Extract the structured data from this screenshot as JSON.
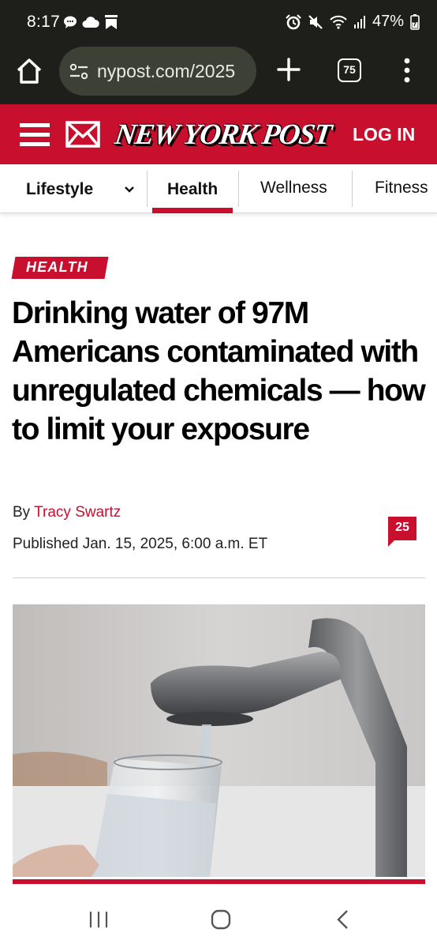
{
  "status_bar": {
    "time": "8:17",
    "battery": "47%"
  },
  "browser": {
    "url": "nypost.com/2025",
    "tab_count": "75"
  },
  "header": {
    "logo": "NEW YORK POST",
    "login_label": "LOG IN",
    "brand_color": "#c8102e"
  },
  "section_nav": {
    "dropdown_label": "Lifestyle",
    "items": [
      "Health",
      "Wellness",
      "Fitness"
    ],
    "active": "Health"
  },
  "article": {
    "tag": "HEALTH",
    "headline": "Drinking water of 97M Americans contaminated with unregulated chemicals — how to limit your exposure",
    "byline_prefix": "By",
    "author": "Tracy Swartz",
    "published": "Published Jan. 15, 2025, 6:00 a.m. ET",
    "comment_count": "25"
  },
  "icons": {
    "status_left": [
      "chat-bubble-icon",
      "cloud-icon",
      "bookmark-flag-icon"
    ],
    "status_right": [
      "alarm-icon",
      "mute-icon",
      "wifi-icon",
      "signal-icon",
      "battery-icon"
    ],
    "browser": [
      "home-icon",
      "site-settings-icon",
      "plus-icon",
      "tabs-icon",
      "more-vert-icon"
    ],
    "header": [
      "hamburger-menu-icon",
      "mail-icon"
    ],
    "android_nav": [
      "recents-icon",
      "home-circle-icon",
      "back-chevron-icon"
    ]
  }
}
